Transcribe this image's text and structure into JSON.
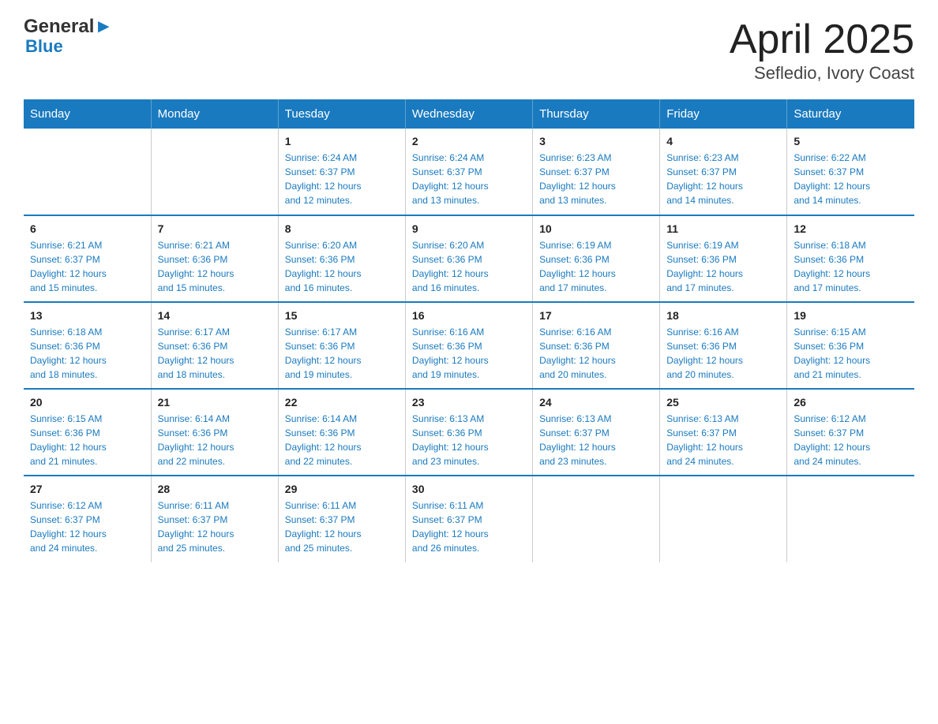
{
  "header": {
    "title": "April 2025",
    "subtitle": "Sefledio, Ivory Coast",
    "logo_general": "General",
    "logo_blue": "Blue"
  },
  "days_of_week": [
    "Sunday",
    "Monday",
    "Tuesday",
    "Wednesday",
    "Thursday",
    "Friday",
    "Saturday"
  ],
  "weeks": [
    [
      {
        "day": "",
        "info": ""
      },
      {
        "day": "",
        "info": ""
      },
      {
        "day": "1",
        "info": "Sunrise: 6:24 AM\nSunset: 6:37 PM\nDaylight: 12 hours\nand 12 minutes."
      },
      {
        "day": "2",
        "info": "Sunrise: 6:24 AM\nSunset: 6:37 PM\nDaylight: 12 hours\nand 13 minutes."
      },
      {
        "day": "3",
        "info": "Sunrise: 6:23 AM\nSunset: 6:37 PM\nDaylight: 12 hours\nand 13 minutes."
      },
      {
        "day": "4",
        "info": "Sunrise: 6:23 AM\nSunset: 6:37 PM\nDaylight: 12 hours\nand 14 minutes."
      },
      {
        "day": "5",
        "info": "Sunrise: 6:22 AM\nSunset: 6:37 PM\nDaylight: 12 hours\nand 14 minutes."
      }
    ],
    [
      {
        "day": "6",
        "info": "Sunrise: 6:21 AM\nSunset: 6:37 PM\nDaylight: 12 hours\nand 15 minutes."
      },
      {
        "day": "7",
        "info": "Sunrise: 6:21 AM\nSunset: 6:36 PM\nDaylight: 12 hours\nand 15 minutes."
      },
      {
        "day": "8",
        "info": "Sunrise: 6:20 AM\nSunset: 6:36 PM\nDaylight: 12 hours\nand 16 minutes."
      },
      {
        "day": "9",
        "info": "Sunrise: 6:20 AM\nSunset: 6:36 PM\nDaylight: 12 hours\nand 16 minutes."
      },
      {
        "day": "10",
        "info": "Sunrise: 6:19 AM\nSunset: 6:36 PM\nDaylight: 12 hours\nand 17 minutes."
      },
      {
        "day": "11",
        "info": "Sunrise: 6:19 AM\nSunset: 6:36 PM\nDaylight: 12 hours\nand 17 minutes."
      },
      {
        "day": "12",
        "info": "Sunrise: 6:18 AM\nSunset: 6:36 PM\nDaylight: 12 hours\nand 17 minutes."
      }
    ],
    [
      {
        "day": "13",
        "info": "Sunrise: 6:18 AM\nSunset: 6:36 PM\nDaylight: 12 hours\nand 18 minutes."
      },
      {
        "day": "14",
        "info": "Sunrise: 6:17 AM\nSunset: 6:36 PM\nDaylight: 12 hours\nand 18 minutes."
      },
      {
        "day": "15",
        "info": "Sunrise: 6:17 AM\nSunset: 6:36 PM\nDaylight: 12 hours\nand 19 minutes."
      },
      {
        "day": "16",
        "info": "Sunrise: 6:16 AM\nSunset: 6:36 PM\nDaylight: 12 hours\nand 19 minutes."
      },
      {
        "day": "17",
        "info": "Sunrise: 6:16 AM\nSunset: 6:36 PM\nDaylight: 12 hours\nand 20 minutes."
      },
      {
        "day": "18",
        "info": "Sunrise: 6:16 AM\nSunset: 6:36 PM\nDaylight: 12 hours\nand 20 minutes."
      },
      {
        "day": "19",
        "info": "Sunrise: 6:15 AM\nSunset: 6:36 PM\nDaylight: 12 hours\nand 21 minutes."
      }
    ],
    [
      {
        "day": "20",
        "info": "Sunrise: 6:15 AM\nSunset: 6:36 PM\nDaylight: 12 hours\nand 21 minutes."
      },
      {
        "day": "21",
        "info": "Sunrise: 6:14 AM\nSunset: 6:36 PM\nDaylight: 12 hours\nand 22 minutes."
      },
      {
        "day": "22",
        "info": "Sunrise: 6:14 AM\nSunset: 6:36 PM\nDaylight: 12 hours\nand 22 minutes."
      },
      {
        "day": "23",
        "info": "Sunrise: 6:13 AM\nSunset: 6:36 PM\nDaylight: 12 hours\nand 23 minutes."
      },
      {
        "day": "24",
        "info": "Sunrise: 6:13 AM\nSunset: 6:37 PM\nDaylight: 12 hours\nand 23 minutes."
      },
      {
        "day": "25",
        "info": "Sunrise: 6:13 AM\nSunset: 6:37 PM\nDaylight: 12 hours\nand 24 minutes."
      },
      {
        "day": "26",
        "info": "Sunrise: 6:12 AM\nSunset: 6:37 PM\nDaylight: 12 hours\nand 24 minutes."
      }
    ],
    [
      {
        "day": "27",
        "info": "Sunrise: 6:12 AM\nSunset: 6:37 PM\nDaylight: 12 hours\nand 24 minutes."
      },
      {
        "day": "28",
        "info": "Sunrise: 6:11 AM\nSunset: 6:37 PM\nDaylight: 12 hours\nand 25 minutes."
      },
      {
        "day": "29",
        "info": "Sunrise: 6:11 AM\nSunset: 6:37 PM\nDaylight: 12 hours\nand 25 minutes."
      },
      {
        "day": "30",
        "info": "Sunrise: 6:11 AM\nSunset: 6:37 PM\nDaylight: 12 hours\nand 26 minutes."
      },
      {
        "day": "",
        "info": ""
      },
      {
        "day": "",
        "info": ""
      },
      {
        "day": "",
        "info": ""
      }
    ]
  ]
}
